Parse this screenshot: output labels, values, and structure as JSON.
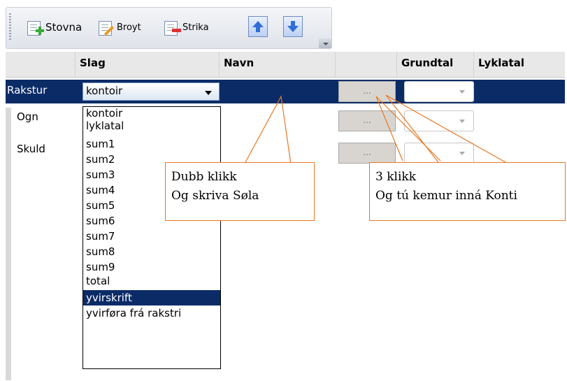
{
  "toolbar": {
    "stovna_label": "Stovna",
    "broyt_label": "Broyt",
    "strika_label": "Strika"
  },
  "grid": {
    "headers": [
      "Slag",
      "Navn",
      "Grundtal",
      "Lyklatal"
    ],
    "rows": [
      {
        "label": "Rakstur",
        "slag": "kontoir"
      },
      {
        "label": "Ogn"
      },
      {
        "label": "Skuld"
      }
    ],
    "ellipsis_text": "..."
  },
  "dropdown": {
    "options": [
      "kontoir",
      "lyklatal",
      "sum1",
      "sum2",
      "sum3",
      "sum4",
      "sum5",
      "sum6",
      "sum7",
      "sum8",
      "sum9",
      "total",
      "yvirskrift",
      "yvirføra frá rakstri"
    ],
    "selected": "yvirskrift"
  },
  "callouts": {
    "left": {
      "line1": "Dubb klikk",
      "line2": "Og skriva Søla"
    },
    "right": {
      "line1": "3 klikk",
      "line2": "Og tú kemur inná Konti"
    }
  },
  "colors": {
    "selection": "#0b2b66",
    "callout_border": "#e87722"
  }
}
